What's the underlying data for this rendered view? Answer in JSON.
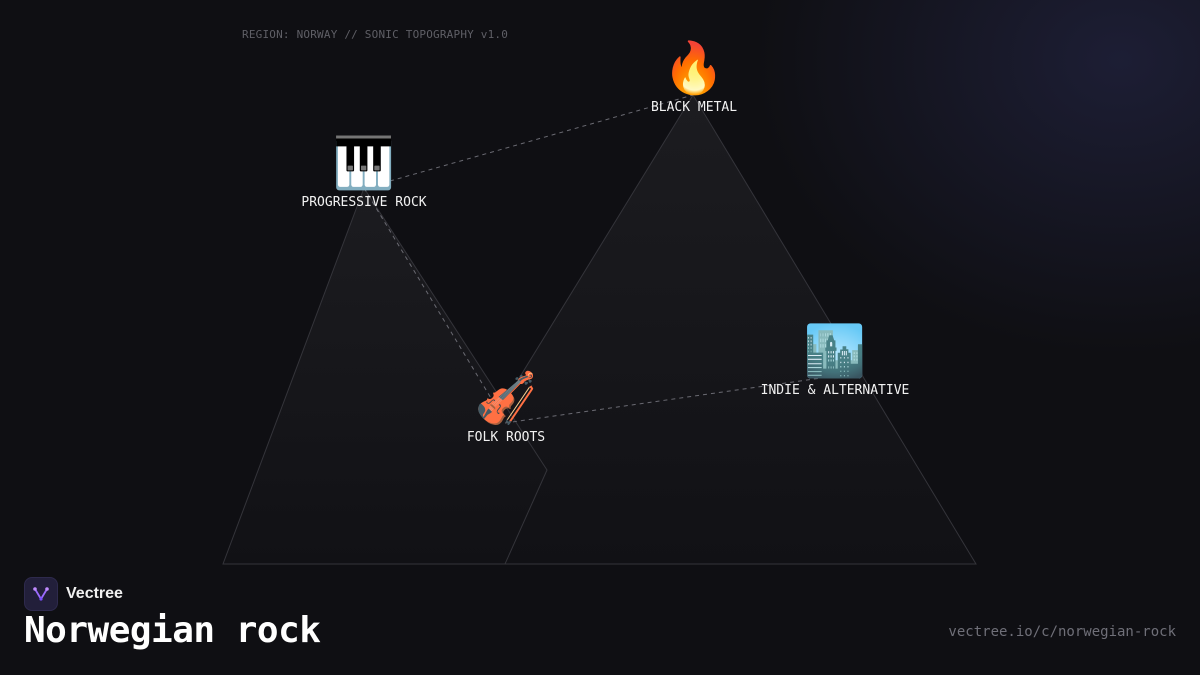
{
  "header": {
    "region_label": "REGION: NORWAY // SONIC TOPOGRAPHY v1.0"
  },
  "nodes": [
    {
      "id": "black-metal",
      "label": "BLACK METAL",
      "icon": "fire-icon",
      "emoji": "🔥"
    },
    {
      "id": "progressive-rock",
      "label": "PROGRESSIVE ROCK",
      "icon": "piano-keys-icon",
      "emoji": "🎹"
    },
    {
      "id": "folk-roots",
      "label": "FOLK ROOTS",
      "icon": "violin-icon",
      "emoji": "🎻"
    },
    {
      "id": "indie-alternative",
      "label": "INDIE & ALTERNATIVE",
      "icon": "cityscape-icon",
      "emoji": "🏙️"
    }
  ],
  "footer": {
    "brand": "Vectree",
    "title": "Norwegian rock",
    "url": "vectree.io/c/norwegian-rock"
  },
  "colors": {
    "background": "#0f0f13",
    "logo_accent": "#9b6bff"
  }
}
